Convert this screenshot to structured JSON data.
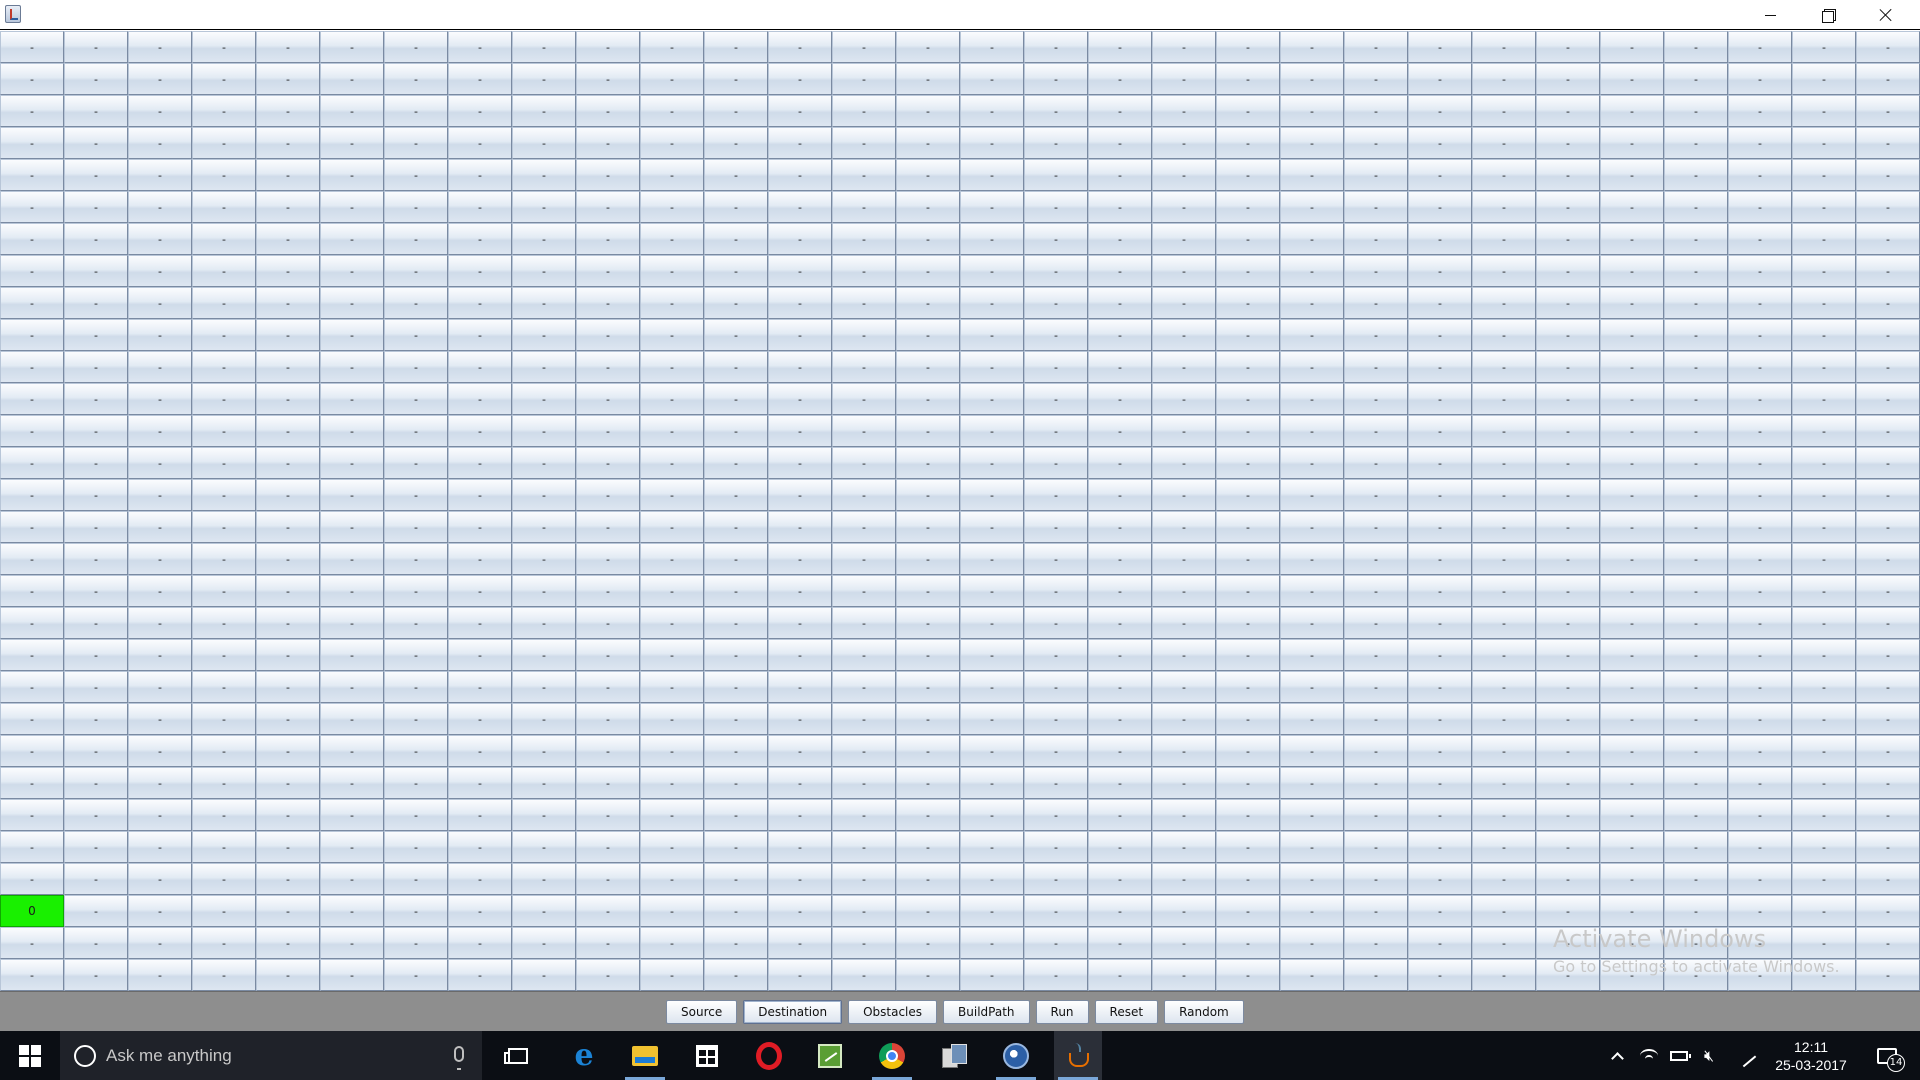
{
  "window": {
    "icon": "java-app-icon",
    "controls": [
      "minimize",
      "maximize",
      "close"
    ]
  },
  "grid": {
    "rows": 30,
    "cols": 30,
    "default_label": "-",
    "source_cell": {
      "row": 27,
      "col": 0,
      "label": "0",
      "color": "#19f000"
    }
  },
  "toolbar": {
    "buttons": [
      {
        "id": "source",
        "label": "Source"
      },
      {
        "id": "destination",
        "label": "Destination",
        "focused": true
      },
      {
        "id": "obstacles",
        "label": "Obstacles"
      },
      {
        "id": "buildpath",
        "label": "BuildPath"
      },
      {
        "id": "run",
        "label": "Run"
      },
      {
        "id": "reset",
        "label": "Reset"
      },
      {
        "id": "random",
        "label": "Random"
      }
    ]
  },
  "watermark": {
    "line1": "Activate Windows",
    "line2": "Go to Settings to activate Windows."
  },
  "taskbar": {
    "search_placeholder": "Ask me anything",
    "apps": [
      "task-view",
      "edge",
      "file-explorer",
      "store",
      "opera",
      "chart-app",
      "chrome",
      "documents",
      "eclipse",
      "java"
    ],
    "clock_time": "12:11",
    "clock_date": "25-03-2017",
    "notification_count": "14"
  }
}
